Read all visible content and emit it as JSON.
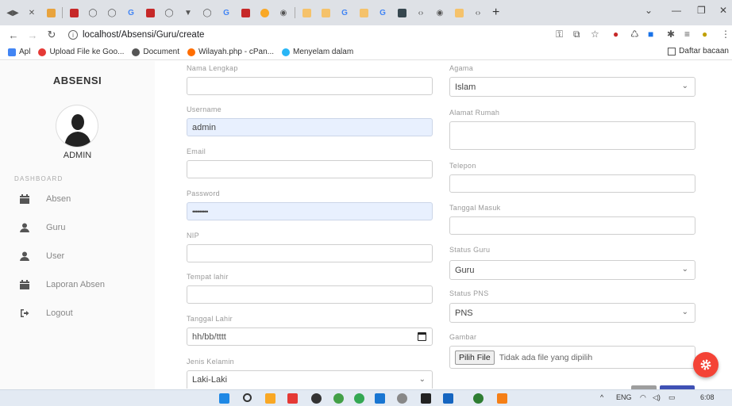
{
  "browser": {
    "url": "localhost/Absensi/Guru/create",
    "bookmarks": [
      "Apl",
      "Upload File ke Goo...",
      "Document",
      "Wilayah.php - cPan...",
      "Menyelam dalam"
    ],
    "reading_list": "Daftar bacaan",
    "new_tab": "+"
  },
  "sidebar": {
    "brand": "ABSENSI",
    "user": "ADMIN",
    "section": "DASHBOARD",
    "items": [
      {
        "label": "Absen",
        "icon": "calendar-icon"
      },
      {
        "label": "Guru",
        "icon": "user-icon"
      },
      {
        "label": "User",
        "icon": "user-icon"
      },
      {
        "label": "Laporan Absen",
        "icon": "calendar-icon"
      },
      {
        "label": "Logout",
        "icon": "logout-icon"
      }
    ]
  },
  "form": {
    "nama_label": "Nama Lengkap",
    "nama_value": "",
    "username_label": "Username",
    "username_value": "admin",
    "email_label": "Email",
    "email_value": "",
    "password_label": "Password",
    "password_value": "•••••••••",
    "nip_label": "NIP",
    "nip_value": "",
    "tempat_label": "Tempat lahir",
    "tempat_value": "",
    "tgl_lahir_label": "Tanggal Lahir",
    "tgl_lahir_placeholder": "hh/bb/tttt",
    "jk_label": "Jenis Kelamin",
    "jk_value": "Laki-Laki",
    "agama_label": "Agama",
    "agama_value": "Islam",
    "alamat_label": "Alamat Rumah",
    "alamat_value": "",
    "telepon_label": "Telepon",
    "telepon_value": "",
    "tgl_masuk_label": "Tanggal Masuk",
    "tgl_masuk_value": "",
    "status_guru_label": "Status Guru",
    "status_guru_value": "Guru",
    "status_pns_label": "Status PNS",
    "status_pns_value": "PNS",
    "gambar_label": "Gambar",
    "file_button": "Pilih File",
    "file_status": "Tidak ada file yang dipilih"
  },
  "taskbar": {
    "lang": "ENG",
    "time": "6:08"
  },
  "colors": {
    "fab": "#f44336",
    "autofill": "#e8f0fe",
    "primary_button": "#3f51b5"
  }
}
